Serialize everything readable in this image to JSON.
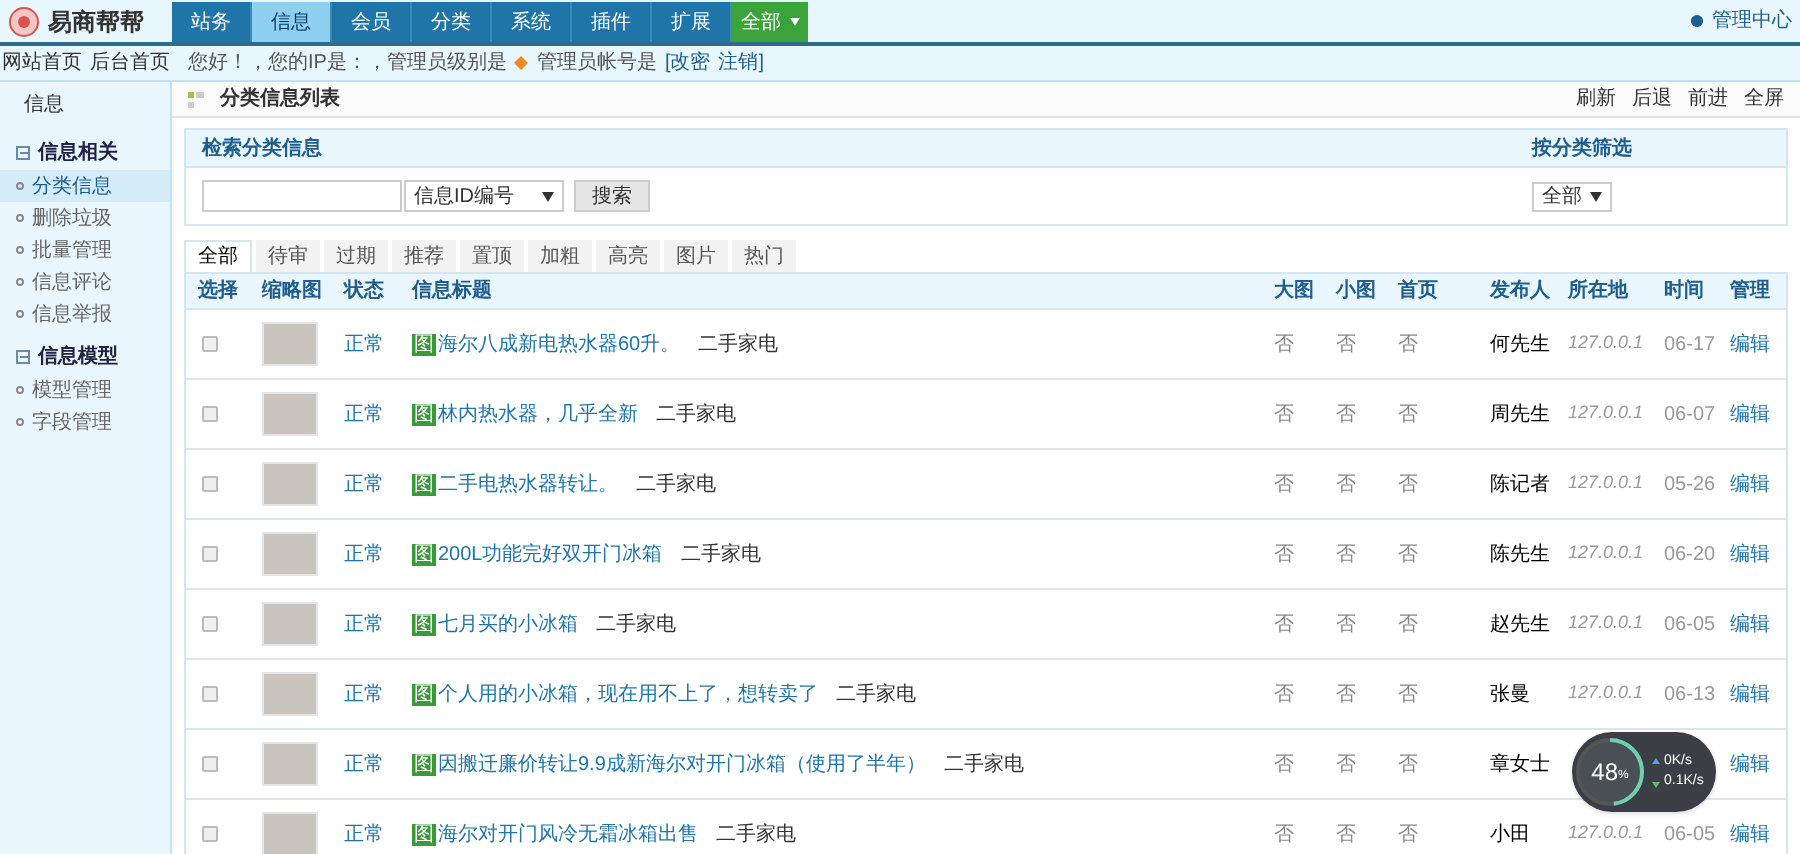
{
  "logo": {
    "text": "易商帮帮"
  },
  "nav": [
    {
      "label": "站务",
      "selected": false,
      "kind": "tab"
    },
    {
      "label": "信息",
      "selected": true,
      "kind": "tab"
    },
    {
      "label": "会员",
      "selected": false,
      "kind": "tab"
    },
    {
      "label": "分类",
      "selected": false,
      "kind": "tab"
    },
    {
      "label": "系统",
      "selected": false,
      "kind": "tab"
    },
    {
      "label": "插件",
      "selected": false,
      "kind": "tab"
    },
    {
      "label": "扩展",
      "selected": false,
      "kind": "tab"
    },
    {
      "label": "全部",
      "selected": false,
      "kind": "dropdown"
    }
  ],
  "admin_link": "管理中心",
  "quick_links": [
    "网站首页",
    "后台首页"
  ],
  "welcome": {
    "text": "您好！，您的IP是：，管理员级别是",
    "account": "管理员帐号是",
    "links": [
      "[改密",
      "注销]"
    ]
  },
  "sidebar": {
    "title": "信息",
    "groups": [
      {
        "label": "信息相关",
        "items": [
          {
            "label": "分类信息",
            "selected": true
          },
          {
            "label": "删除垃圾",
            "selected": false
          },
          {
            "label": "批量管理",
            "selected": false
          },
          {
            "label": "信息评论",
            "selected": false
          },
          {
            "label": "信息举报",
            "selected": false
          }
        ]
      },
      {
        "label": "信息模型",
        "items": [
          {
            "label": "模型管理",
            "selected": false
          },
          {
            "label": "字段管理",
            "selected": false
          }
        ]
      }
    ]
  },
  "page_title": "分类信息列表",
  "page_actions": [
    "刷新",
    "后退",
    "前进",
    "全屏"
  ],
  "search": {
    "title": "检索分类信息",
    "select": "信息ID编号",
    "button": "搜索"
  },
  "filter": {
    "title": "按分类筛选",
    "select": "全部"
  },
  "filter_tabs": [
    {
      "label": "全部",
      "selected": true
    },
    {
      "label": "待审",
      "selected": false
    },
    {
      "label": "过期",
      "selected": false
    },
    {
      "label": "推荐",
      "selected": false
    },
    {
      "label": "置顶",
      "selected": false
    },
    {
      "label": "加粗",
      "selected": false
    },
    {
      "label": "高亮",
      "selected": false
    },
    {
      "label": "图片",
      "selected": false
    },
    {
      "label": "热门",
      "selected": false
    }
  ],
  "table": {
    "columns": [
      "选择",
      "缩略图",
      "状态",
      "信息标题",
      "大图",
      "小图",
      "首页",
      "发布人",
      "所在地",
      "时间",
      "管理"
    ],
    "rows": [
      {
        "checked": false,
        "status": "正常",
        "badge": "图",
        "title": "海尔八成新电热水器60升。",
        "category": "二手家电",
        "c1": "否",
        "c2": "否",
        "c3": "否",
        "author": "何先生",
        "ip": "127.0.0.1",
        "time": "06-17",
        "action": "编辑"
      },
      {
        "checked": false,
        "status": "正常",
        "badge": "图",
        "title": "林内热水器，几乎全新",
        "category": "二手家电",
        "c1": "否",
        "c2": "否",
        "c3": "否",
        "author": "周先生",
        "ip": "127.0.0.1",
        "time": "06-07",
        "action": "编辑"
      },
      {
        "checked": false,
        "status": "正常",
        "badge": "图",
        "title": "二手电热水器转让。",
        "category": "二手家电",
        "c1": "否",
        "c2": "否",
        "c3": "否",
        "author": "陈记者",
        "ip": "127.0.0.1",
        "time": "05-26",
        "action": "编辑"
      },
      {
        "checked": false,
        "status": "正常",
        "badge": "图",
        "title": "200L功能完好双开门冰箱",
        "category": "二手家电",
        "c1": "否",
        "c2": "否",
        "c3": "否",
        "author": "陈先生",
        "ip": "127.0.0.1",
        "time": "06-20",
        "action": "编辑"
      },
      {
        "checked": false,
        "status": "正常",
        "badge": "图",
        "title": "七月买的小冰箱",
        "category": "二手家电",
        "c1": "否",
        "c2": "否",
        "c3": "否",
        "author": "赵先生",
        "ip": "127.0.0.1",
        "time": "06-05",
        "action": "编辑"
      },
      {
        "checked": false,
        "status": "正常",
        "badge": "图",
        "title": "个人用的小冰箱，现在用不上了，想转卖了",
        "category": "二手家电",
        "c1": "否",
        "c2": "否",
        "c3": "否",
        "author": "张曼",
        "ip": "127.0.0.1",
        "time": "06-13",
        "action": "编辑"
      },
      {
        "checked": false,
        "status": "正常",
        "badge": "图",
        "title": "因搬迁廉价转让9.9成新海尔对开门冰箱（使用了半年）",
        "category": "二手家电",
        "c1": "否",
        "c2": "否",
        "c3": "否",
        "author": "章女士",
        "action": "编辑"
      },
      {
        "checked": false,
        "status": "正常",
        "badge": "图",
        "title": "海尔对开门风冷无霜冰箱出售",
        "category": "二手家电",
        "c1": "否",
        "c2": "否",
        "c3": "否",
        "author": "小田",
        "ip": "127.0.0.1",
        "time": "06-05",
        "action": "编辑"
      }
    ]
  },
  "speed_widget": {
    "level": 0.48,
    "percent": "48",
    "unit": "%",
    "upload": "0K/s",
    "download": "0.1K/s"
  }
}
